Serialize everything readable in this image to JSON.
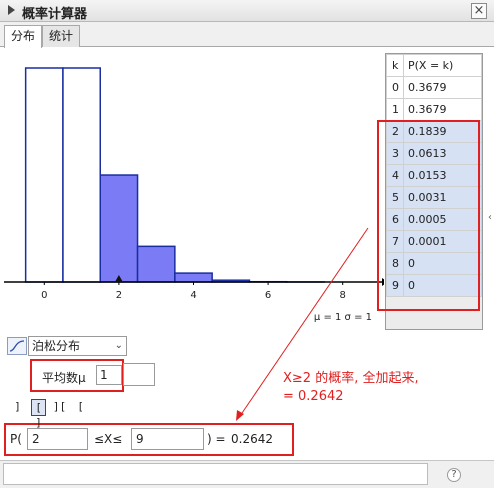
{
  "window": {
    "title": "概率计算器",
    "close_icon": "close-icon"
  },
  "tabs": [
    {
      "label": "分布"
    },
    {
      "label": "统计"
    }
  ],
  "chart_data": {
    "type": "bar",
    "title": "",
    "x": [
      0,
      1,
      2,
      3,
      4,
      5,
      6,
      7,
      8,
      9
    ],
    "values": [
      0.3679,
      0.3679,
      0.1839,
      0.0613,
      0.0153,
      0.0031,
      0.0005,
      0.0001,
      0,
      0
    ],
    "highlight_from": 2,
    "highlight_to": 9,
    "xlim": [
      -1,
      9
    ],
    "ylim": [
      0,
      0.3679
    ],
    "xticks": [
      "0",
      "2",
      "4",
      "6",
      "8"
    ],
    "xtick_values": [
      0,
      2,
      4,
      6,
      8
    ],
    "marker_at": 2,
    "stats_text": "μ = 1    σ = 1",
    "colors": {
      "highlight_fill": "#7b7bf5",
      "outline": "#1a2ea0"
    }
  },
  "table": {
    "headers": [
      "k",
      "P(X = k)"
    ],
    "rows": [
      {
        "k": "0",
        "p": "0.3679"
      },
      {
        "k": "1",
        "p": "0.3679"
      },
      {
        "k": "2",
        "p": "0.1839"
      },
      {
        "k": "3",
        "p": "0.0613"
      },
      {
        "k": "4",
        "p": "0.0153"
      },
      {
        "k": "5",
        "p": "0.0031"
      },
      {
        "k": "6",
        "p": "0.0005"
      },
      {
        "k": "7",
        "p": "0.0001"
      },
      {
        "k": "8",
        "p": "0"
      },
      {
        "k": "9",
        "p": "0"
      }
    ]
  },
  "controls": {
    "distribution": "泊松分布",
    "mean_label": "平均数μ",
    "mean_value": "1",
    "mode_buttons": [
      "]",
      "[ ]",
      "][",
      "["
    ],
    "prob_prefix": "P(",
    "lower": "2",
    "ineq": "≤X≤",
    "upper": "9",
    "eq": ") =",
    "result": "0.2642"
  },
  "annotation": {
    "line1": "X≥2 的概率, 全加起来,",
    "line2": "= 0.2642",
    "color": "#e02020"
  },
  "status": {
    "help_icon": "help-icon"
  }
}
